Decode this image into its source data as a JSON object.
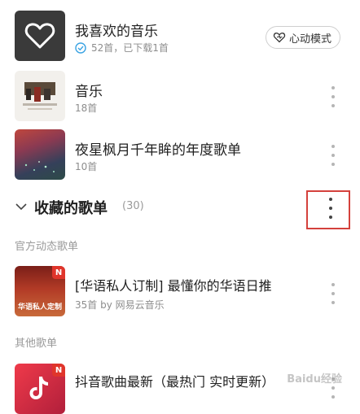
{
  "liked": {
    "title": "我喜欢的音乐",
    "subtitle": "52首，已下载1首",
    "heart_mode_label": "心动模式"
  },
  "playlists_created": [
    {
      "title": "音乐",
      "subtitle": "18首"
    },
    {
      "title": "夜星枫月千年眸的年度歌单",
      "subtitle": "10首"
    }
  ],
  "collected": {
    "header": "收藏的歌单",
    "count": "(30)",
    "official_label": "官方动态歌单",
    "official_item": {
      "title": "[华语私人订制] 最懂你的华语日推",
      "subtitle": "35首 by 网易云音乐",
      "cover_text": "华语私人定制"
    },
    "other_label": "其他歌单",
    "other_item": {
      "title": "抖音歌曲最新（最热门 实时更新）"
    }
  },
  "badge_letter": "N",
  "watermark": "Baidu经验",
  "colors": {
    "highlight_box": "#d4413c",
    "accent_red": "#e0352b"
  }
}
